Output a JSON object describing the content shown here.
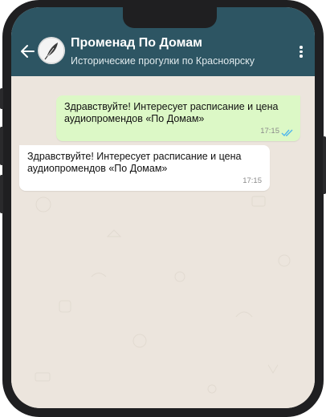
{
  "header": {
    "title": "Променад По Домам",
    "subtitle": "Исторические прогулки по Красноярску",
    "color": "#2d5563"
  },
  "messages": [
    {
      "direction": "outgoing",
      "text": "Здравствуйте! Интересует расписание и цена аудиопромендов «По Домам»",
      "time": "17:15",
      "status": "read",
      "bubble_color": "#dcf8c6",
      "ticks_color": "#4fb6ec"
    },
    {
      "direction": "incoming",
      "text": "Здравствуйте! Интересует расписание и цена аудиопромендов «По Домам»",
      "time": "17:15",
      "bubble_color": "#ffffff"
    }
  ],
  "icons": {
    "back": "back-arrow-icon",
    "avatar": "feather-logo",
    "menu": "more-vertical-icon",
    "status": "double-check-icon"
  },
  "chat_background": "#ece5dd"
}
